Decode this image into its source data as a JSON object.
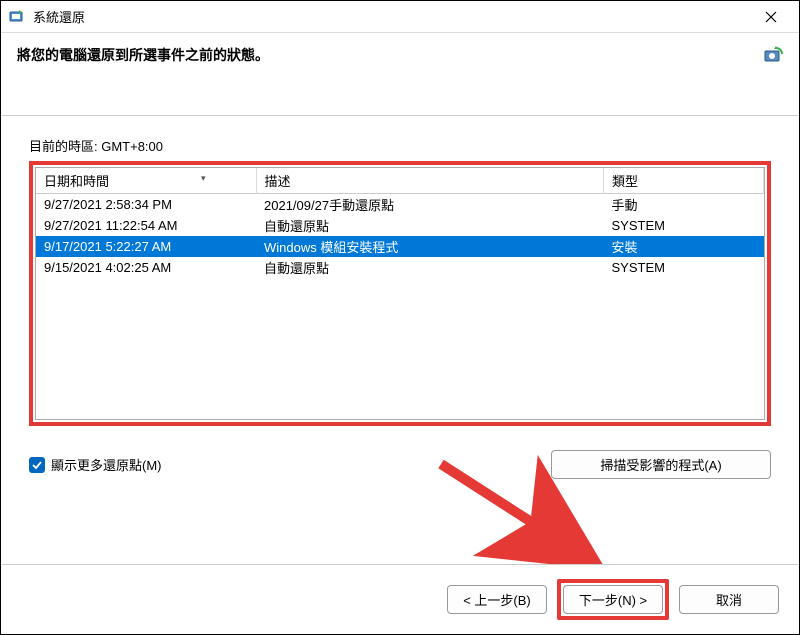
{
  "window": {
    "title": "系統還原"
  },
  "header": {
    "subtitle": "將您的電腦還原到所選事件之前的狀態。"
  },
  "timezone_label": "目前的時區: GMT+8:00",
  "table": {
    "columns": {
      "date": "日期和時間",
      "desc": "描述",
      "type": "類型"
    },
    "rows": [
      {
        "date": "9/27/2021 2:58:34 PM",
        "desc": "2021/09/27手動還原點",
        "type": "手動",
        "selected": false
      },
      {
        "date": "9/27/2021 11:22:54 AM",
        "desc": "自動還原點",
        "type": "SYSTEM",
        "selected": false
      },
      {
        "date": "9/17/2021 5:22:27 AM",
        "desc": "Windows 模組安裝程式",
        "type": "安裝",
        "selected": true
      },
      {
        "date": "9/15/2021 4:02:25 AM",
        "desc": "自動還原點",
        "type": "SYSTEM",
        "selected": false
      }
    ]
  },
  "show_more_label": "顯示更多還原點(M)",
  "scan_label": "掃描受影響的程式(A)",
  "buttons": {
    "back": "< 上一步(B)",
    "next": "下一步(N) >",
    "cancel": "取消"
  }
}
